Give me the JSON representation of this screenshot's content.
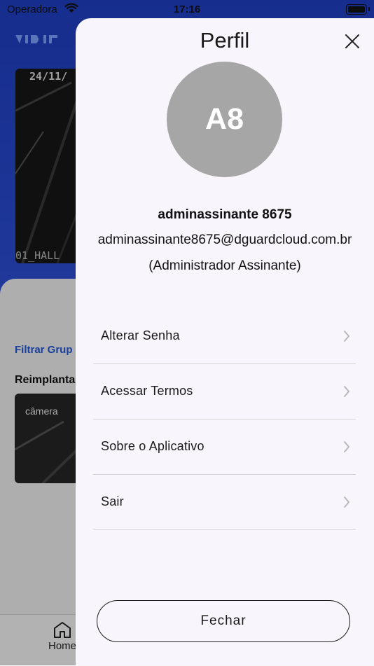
{
  "status_bar": {
    "carrier": "Operadora",
    "time": "17:16"
  },
  "background": {
    "camera": {
      "date_osd": "24/11/",
      "name_osd": "01_HALL"
    },
    "filter_link": "Filtrar Grup",
    "section_title": "Reimplanta",
    "thumb_label": "câmera",
    "tab_home": "Home"
  },
  "modal": {
    "title": "Perfil",
    "avatar_initials": "A8",
    "user": {
      "name": "adminassinante 8675",
      "email": "adminassinante8675@dguardcloud.com.br",
      "role": "(Administrador Assinante)"
    },
    "menu": [
      {
        "label": "Alterar Senha"
      },
      {
        "label": "Acessar Termos"
      },
      {
        "label": "Sobre o Aplicativo"
      },
      {
        "label": "Sair"
      }
    ],
    "close_button": "Fechar"
  },
  "colors": {
    "brand_blue": "#2c4fd6",
    "avatar_gray": "#a6a6a6",
    "modal_bg": "#f8f6fc"
  }
}
